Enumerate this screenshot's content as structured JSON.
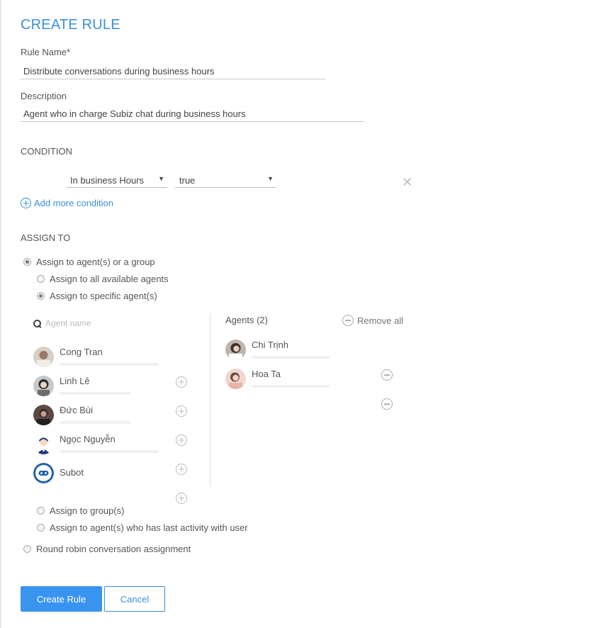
{
  "title": "CREATE RULE",
  "rule_name": {
    "label": "Rule Name*",
    "value": "Distribute conversations during business hours"
  },
  "description": {
    "label": "Description",
    "value": "Agent  who in charge Subiz chat during business hours"
  },
  "condition": {
    "heading": "CONDITION",
    "field_value": "In business Hours",
    "operand_value": "true",
    "add_more_label": "Add more condition"
  },
  "assign": {
    "heading": "ASSIGN TO",
    "option_agents_group": "Assign to agent(s) or a group",
    "option_all_available": "Assign to all available agents",
    "option_specific": "Assign to specific agent(s)",
    "option_groups": "Assign to group(s)",
    "option_last_activity": "Assign to agent(s) who has last activity with user",
    "option_round_robin": "Round robin conversation assignment"
  },
  "agent_picker": {
    "search_placeholder": "Agent name",
    "available": [
      {
        "name": "Cong Tran"
      },
      {
        "name": "Linh Lê"
      },
      {
        "name": "Đức Bùi"
      },
      {
        "name": "Ngọc Nguyễn"
      },
      {
        "name": "Subot"
      }
    ],
    "selected_header": "Agents (2)",
    "remove_all_label": "Remove all",
    "selected": [
      {
        "name": "Chi Trịnh"
      },
      {
        "name": "Hoa Ta"
      }
    ]
  },
  "buttons": {
    "create": "Create Rule",
    "cancel": "Cancel"
  },
  "colors": {
    "accent": "#3b8fdb",
    "primary_button": "#3994f0"
  }
}
